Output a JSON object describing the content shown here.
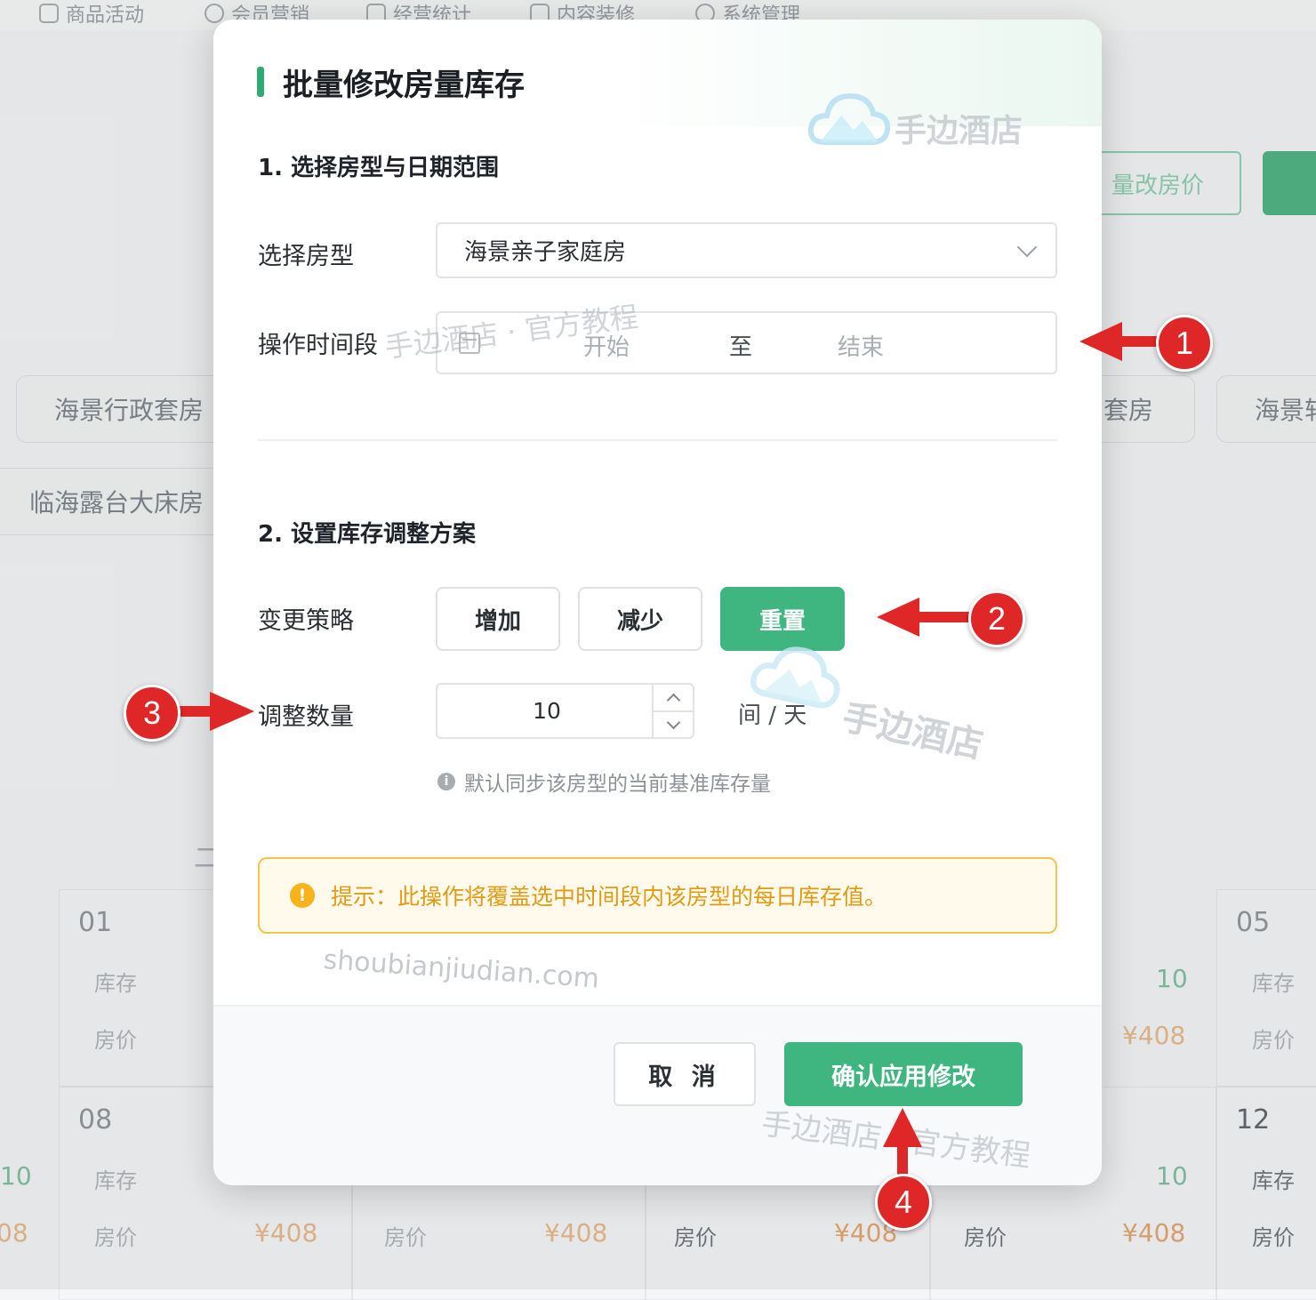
{
  "background": {
    "nav": [
      "商品活动",
      "会员营销",
      "经营统计",
      "内容装修",
      "系统管理"
    ],
    "bulk_price_button": "量改房价",
    "room_chips": [
      "海景行政套房",
      "套房",
      "海景轩",
      "临海露台大床房"
    ],
    "calendar": {
      "days": [
        "01",
        "05",
        "08",
        "12"
      ],
      "stock_label": "库存",
      "price_label": "房价",
      "stock_value": "10",
      "price_value": "¥408",
      "partial_price": "08",
      "partial_stock": "10",
      "cut_char": "二"
    }
  },
  "modal": {
    "title": "批量修改房量库存",
    "section1": "1. 选择房型与日期范围",
    "room_type_label": "选择房型",
    "room_type_value": "海景亲子家庭房",
    "period_label": "操作时间段",
    "period_start_placeholder": "开始",
    "period_separator": "至",
    "period_end_placeholder": "结束",
    "section2": "2. 设置库存调整方案",
    "strategy_label": "变更策略",
    "strategy_options": [
      "增加",
      "减少",
      "重置"
    ],
    "strategy_selected": "重置",
    "quantity_label": "调整数量",
    "quantity_value": "10",
    "quantity_unit": "间 / 天",
    "quantity_hint": "默认同步该房型的当前基准库存量",
    "alert_text": "提示：此操作将覆盖选中时间段内该房型的每日库存值。",
    "cancel_label": "取 消",
    "confirm_label": "确认应用修改"
  },
  "watermarks": {
    "brand": "手边酒店",
    "tutorial_1": "手边酒店 · 官方教程",
    "tutorial_2": "手边酒店 · 官方教程",
    "domain": "shoubianjiudian.com"
  },
  "annotations": [
    "1",
    "2",
    "3",
    "4"
  ],
  "colors": {
    "accent": "#3fb57f",
    "warning": "#f6b31c",
    "annotation": "#e02727"
  }
}
